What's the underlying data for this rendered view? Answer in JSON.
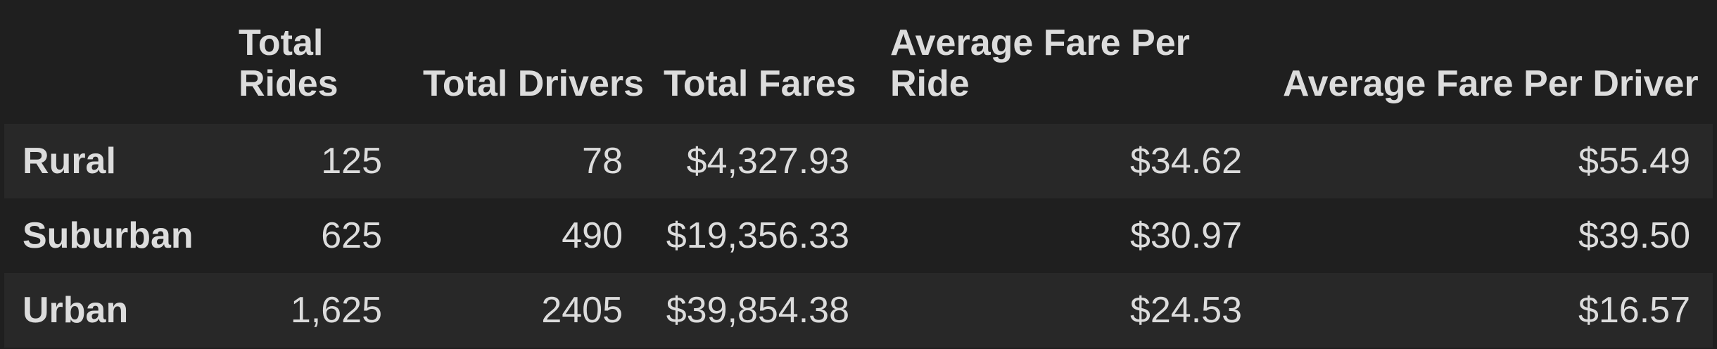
{
  "table": {
    "columns": [
      "",
      "Total Rides",
      "Total Drivers",
      "Total Fares",
      "Average Fare Per Ride",
      "Average Fare Per Driver"
    ],
    "rows": [
      {
        "label": "Rural",
        "cells": [
          "125",
          "78",
          "$4,327.93",
          "$34.62",
          "$55.49"
        ]
      },
      {
        "label": "Suburban",
        "cells": [
          "625",
          "490",
          "$19,356.33",
          "$30.97",
          "$39.50"
        ]
      },
      {
        "label": "Urban",
        "cells": [
          "1,625",
          "2405",
          "$39,854.38",
          "$24.53",
          "$16.57"
        ]
      }
    ]
  },
  "colors": {
    "background": "#1f1f1f",
    "row_stripe": "#282828",
    "text": "#dcdcdc"
  }
}
